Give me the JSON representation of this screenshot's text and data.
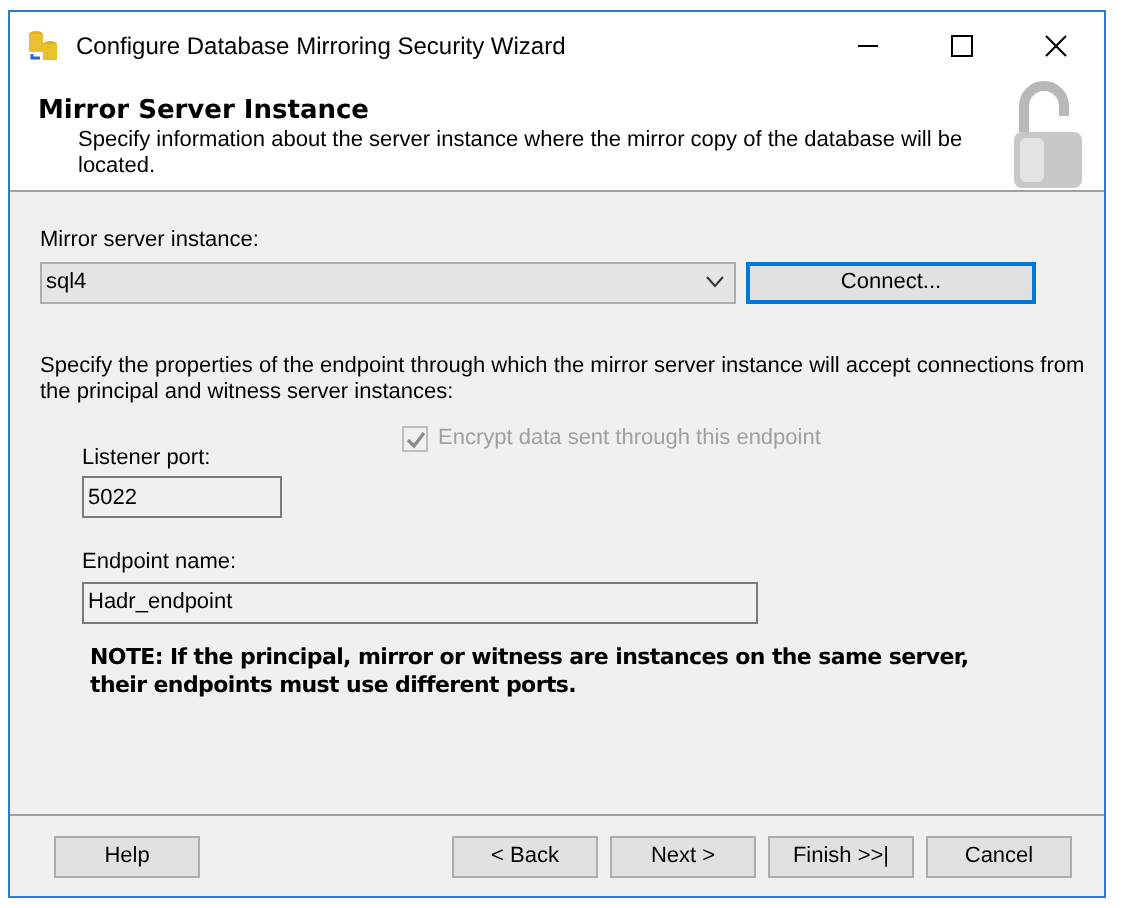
{
  "window": {
    "title": "Configure Database Mirroring Security Wizard"
  },
  "header": {
    "title": "Mirror Server Instance",
    "description": "Specify information about the server instance where the mirror copy of the database will be located."
  },
  "mirror_server": {
    "label": "Mirror server instance:",
    "value": "sql4",
    "connect_button": "Connect...",
    "connect_focused": true
  },
  "endpoint_intro": "Specify the properties of the endpoint through which the mirror server instance will accept connections from the principal and witness server instances:",
  "listener_port": {
    "label": "Listener port:",
    "value": "5022"
  },
  "encrypt": {
    "label": "Encrypt data sent through this endpoint",
    "checked": true,
    "disabled": true
  },
  "endpoint_name": {
    "label": "Endpoint name:",
    "value": "Hadr_endpoint"
  },
  "note": "NOTE: If the principal, mirror or witness are instances on the same server, their endpoints must use different ports.",
  "buttons": [
    {
      "label": "Help",
      "kind": "left"
    },
    {
      "label": "< Back",
      "kind": "right"
    },
    {
      "label": "Next >",
      "kind": "right"
    },
    {
      "label": "Finish >>|",
      "kind": "right"
    },
    {
      "label": "Cancel",
      "kind": "right"
    }
  ]
}
